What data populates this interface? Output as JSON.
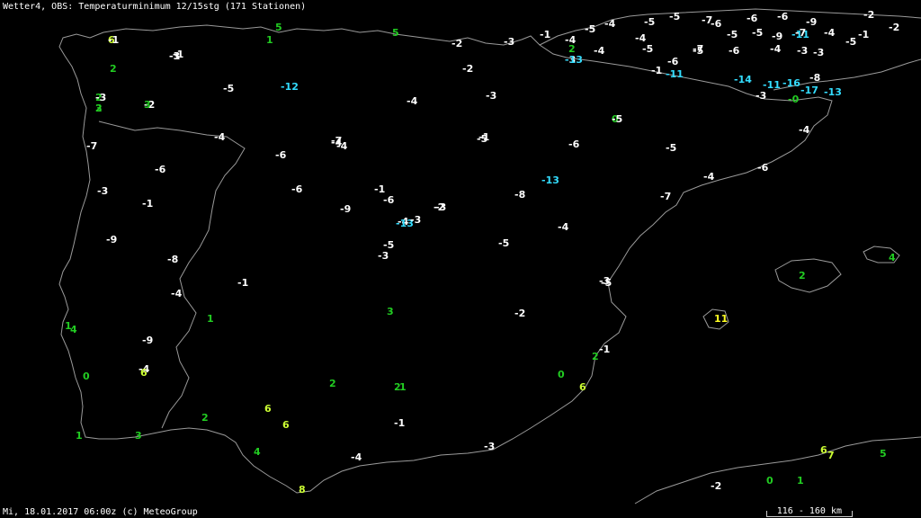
{
  "header": {
    "title": "Wetter4, OBS: Temperaturminimum 12/15stg (171 Stationen)"
  },
  "footer": {
    "timestamp": "Mi, 18.01.2017 06:00z (c) MeteoGroup"
  },
  "scale": {
    "label": "116 - 160 km"
  },
  "colors": {
    "background": "#000000",
    "coast": "#9a9a9a",
    "cold": "#ffffff",
    "very_cold": "#33ddff",
    "mild": "#22cc22",
    "warm": "#ccff33",
    "warmest": "#ffff22"
  },
  "stations": [
    "6",
    "-1",
    "5",
    "1",
    "5",
    "-2",
    "-3",
    "-1",
    "2",
    "-3",
    "2",
    "-4",
    "-5",
    "-4",
    "-5",
    "-5",
    "-7",
    "-5",
    "-6",
    "-6",
    "-9",
    "-11",
    "-5",
    "-4",
    "-2",
    "2",
    "-1",
    "-5",
    "-12",
    "-4",
    "-2",
    "-13",
    "-4",
    "-5",
    "-5",
    "-4",
    "-6",
    "-7",
    "-6",
    "-9",
    "-7",
    "-4",
    "-5",
    "-1",
    "-2",
    "-3",
    "-3",
    "-3",
    "3",
    "3",
    "-2",
    "-4",
    "-4",
    "-6",
    "-5",
    "-6",
    "-6",
    "-4",
    "-3",
    "-1",
    "-11",
    "-14",
    "-11",
    "-16",
    "-17",
    "-8",
    "-3",
    "-0",
    "-13",
    "-7",
    "0",
    "2",
    "-6",
    "-4",
    "-3",
    "-6",
    "-5",
    "-1",
    "-7",
    "-6",
    "-4",
    "-1",
    "-5",
    "-3",
    "-5",
    "-1",
    "-6",
    "-8",
    "-13",
    "-13",
    "-9",
    "-3",
    "-7",
    "-4",
    "1",
    "-3",
    "-2",
    "-4",
    "-5",
    "-9",
    "-8",
    "3",
    "-1",
    "-4",
    "-3",
    "0",
    "-5",
    "1",
    "-1",
    "-2",
    "-4",
    "-9",
    "2",
    "-1",
    "0",
    "1",
    "6",
    "6",
    "2",
    "2",
    "-3",
    "-2",
    "6",
    "1",
    "3",
    "6",
    "7",
    "4",
    "2",
    "4",
    "-4",
    "4",
    "8",
    "6",
    "11",
    "5",
    "2",
    "0",
    "1",
    "-1",
    "-3"
  ]
}
